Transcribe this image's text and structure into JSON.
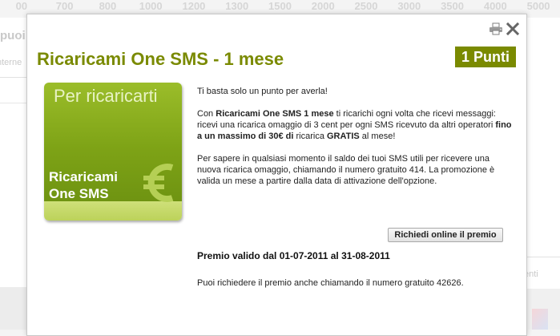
{
  "background": {
    "scale_labels": [
      "00",
      "700",
      "800",
      "1000",
      "1200",
      "1300",
      "1500",
      "2000",
      "2500",
      "3000",
      "3500",
      "4000",
      "5000",
      "2500"
    ],
    "left_title": "puoi",
    "left_sub": "nterne",
    "right_sub": "enti"
  },
  "modal": {
    "title": "Ricaricami One SMS - 1 mese",
    "points_badge": "1 Punti",
    "card": {
      "tagline": "Per ricaricarti",
      "name_line1": "Ricaricami",
      "name_line2": "One SMS",
      "icon": "euro-icon"
    },
    "description": {
      "intro": "Ti basta solo un punto per averla!",
      "p2_prefix": "Con ",
      "p2_bold1": "Ricaricami One SMS 1 mese",
      "p2_mid": " ti ricarichi ogni volta che ricevi messaggi: ricevi una ricarica omaggio di 3 cent per ogni SMS ricevuto da altri operatori ",
      "p2_bold2": "fino a un massimo di 30€ di",
      "p2_mid2": " ricarica ",
      "p2_bold3": "GRATIS",
      "p2_suffix": " al mese!",
      "p3": "Per sapere in qualsiasi momento il saldo dei tuoi SMS utili per ricevere una nuova ricarica omaggio, chiamando il numero gratuito 414. La promozione è valida un mese a partire dalla data di attivazione dell'opzione."
    },
    "request_button_label": "Richiedi online il premio",
    "validity": "Premio valido dal 01-07-2011 al 31-08-2011",
    "phone_note": "Puoi richiedere il premio anche chiamando il numero gratuito 42626.",
    "icons": {
      "print": "print-icon",
      "close": "close-icon"
    },
    "colors": {
      "accent": "#7a8a00",
      "card_green": "#8cb121"
    }
  }
}
